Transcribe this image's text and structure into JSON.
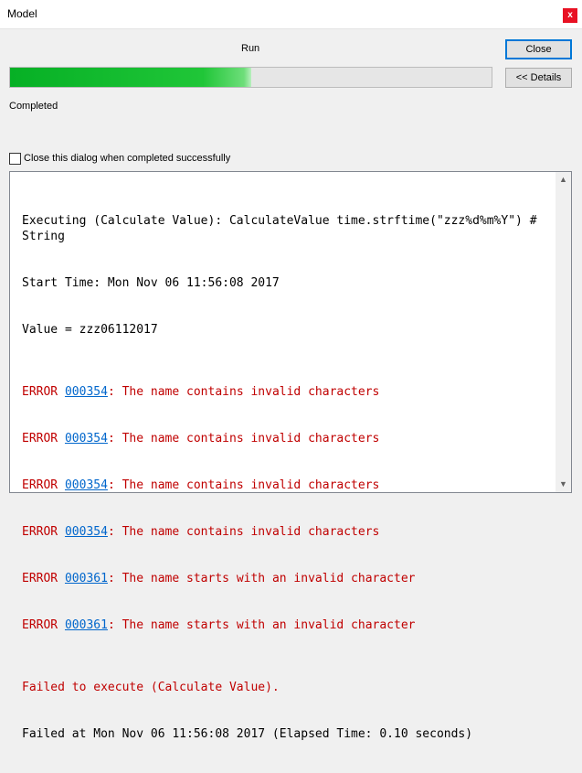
{
  "window": {
    "title": "Model",
    "close_glyph": "x"
  },
  "run_label": "Run",
  "buttons": {
    "close": "Close",
    "details": "<< Details"
  },
  "progress": {
    "fraction": 0.5
  },
  "status": "Completed",
  "checkbox": {
    "label": "Close this dialog when completed successfully",
    "checked": false
  },
  "log": {
    "intro": [
      "Executing (Calculate Value): CalculateValue time.strftime(\"zzz%d%m%Y\") # String",
      "Start Time: Mon Nov 06 11:56:08 2017",
      "Value = zzz06112017"
    ],
    "errors": [
      {
        "prefix": "ERROR ",
        "code": "000354",
        "message": ": The name contains invalid characters"
      },
      {
        "prefix": "ERROR ",
        "code": "000354",
        "message": ": The name contains invalid characters"
      },
      {
        "prefix": "ERROR ",
        "code": "000354",
        "message": ": The name contains invalid characters"
      },
      {
        "prefix": "ERROR ",
        "code": "000354",
        "message": ": The name contains invalid characters"
      },
      {
        "prefix": "ERROR ",
        "code": "000361",
        "message": ": The name starts with an invalid character"
      },
      {
        "prefix": "ERROR ",
        "code": "000361",
        "message": ": The name starts with an invalid character"
      }
    ],
    "failed": "Failed to execute (Calculate Value).",
    "final": "Failed at Mon Nov 06 11:56:08 2017 (Elapsed Time: 0.10 seconds)"
  },
  "colors": {
    "error": "#c00000",
    "link": "#0066cc",
    "progress": "#06b025"
  }
}
